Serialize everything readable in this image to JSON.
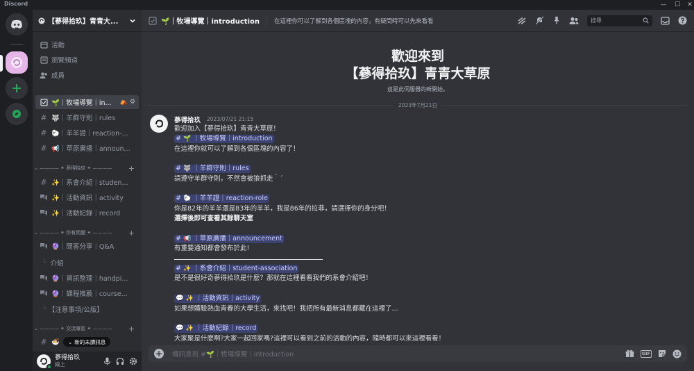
{
  "window": {
    "app_name": "Discord",
    "controls": [
      "minimize-icon",
      "maximize-icon",
      "close-icon"
    ]
  },
  "rail": {
    "icons": [
      "discord-logo-icon",
      "server-avatar-icon",
      "add-server-icon",
      "discover-icon"
    ],
    "accent": "#23a55a"
  },
  "server": {
    "name": "【蔘得拾玖】青青大..."
  },
  "nav": {
    "events": "活動",
    "browse": "瀏覽頻道",
    "members": "成員"
  },
  "channels": [
    {
      "emoji": "🌱",
      "label": "｜牧場導覽｜in...",
      "type": "rules-channel-icon",
      "active": true
    },
    {
      "emoji": "🐺",
      "label": "｜羊群守則｜rules",
      "type": "text-channel-icon"
    },
    {
      "emoji": "🐑",
      "label": "｜羊羊證｜reaction-...",
      "type": "text-channel-icon"
    },
    {
      "emoji": "📢",
      "label": "｜草原廣播｜announ...",
      "type": "text-channel-icon"
    }
  ],
  "categories": [
    {
      "label": "———— ✴ 蔘得拾玖 ✴ ————",
      "channels": [
        {
          "emoji": "✨",
          "label": "｜系會介紹｜studen...",
          "type": "text-channel-icon"
        },
        {
          "emoji": "✨",
          "label": "｜活動資訊｜activity",
          "type": "forum-channel-icon"
        },
        {
          "emoji": "✨",
          "label": "｜活動紀錄｜record",
          "type": "forum-channel-icon"
        }
      ]
    },
    {
      "label": "———— ✴ 你有問題 ✴ ————",
      "channels": [
        {
          "emoji": "🔮",
          "label": "｜問答分享｜Q&A",
          "type": "forum-channel-icon"
        },
        {
          "emoji": "🔮",
          "label": "｜資訊整理｜handpi...",
          "type": "forum-channel-icon"
        },
        {
          "emoji": "🔮",
          "label": "｜課程推薦｜course...",
          "type": "forum-channel-icon"
        }
      ],
      "threads": [
        "介紹",
        "【注意事項/公版】"
      ]
    },
    {
      "label": "———— ✴ 交流專區 ✴ ————",
      "channels": [
        {
          "emoji": "🍜",
          "label": "",
          "type": "text-channel-icon"
        }
      ]
    }
  ],
  "new_unread": "新的未讀訊息",
  "user": {
    "name": "蔘得拾玖",
    "status": "線上"
  },
  "header": {
    "channel_emoji": "🌱",
    "channel_name": "｜牧場導覽｜introduction",
    "topic": "在這裡你可以了解到各個區塊的內容，有疑問時可以先來看看",
    "search_placeholder": "搜尋"
  },
  "welcome": {
    "line1": "歡迎來到",
    "line2": "【蔘得拾玖】青青大草原",
    "subtitle": "這是此伺服器的新開始。",
    "date": "2023年7月21日"
  },
  "message": {
    "author": "蔘得拾玖",
    "timestamp": "2023/07/21 21:15",
    "lines": [
      "歡迎加入【蔘得拾玖】青青大草原！",
      "在這裡你就可以了解到各個區塊的內容了！",
      "請遵守羊群守則，不然會被狼抓走｀´",
      "你是82年的羊羊還是83年的羊羊，我是86年的拉菲，請選擇你的身分吧！",
      "選擇後即可查看其餘聊天室",
      "有重要通知都會發布於此!",
      "是不是很好奇蔘得拾玖是什麼？那就在這裡看看我們的系會介紹吧！",
      "如果想體驗熱血青春的大學生活，來找吧！我把所有最新消息都藏在這裡了...",
      "大家聚是什麼啊?大家一起回家嗎?這裡可以看到之前的活動的內容，隨時都可以來這裡看看！"
    ],
    "mentions": [
      {
        "prefix": "#",
        "emoji": "🌱",
        "text": "｜牧場導覽｜introduction"
      },
      {
        "prefix": "#",
        "emoji": "🐺",
        "text": "｜羊群守則｜rules"
      },
      {
        "prefix": "#",
        "emoji": "🐑",
        "text": "｜羊羊證｜reaction-role"
      },
      {
        "prefix": "#",
        "emoji": "📢",
        "text": "｜草原廣播｜announcement"
      },
      {
        "prefix": "#",
        "emoji": "✨",
        "text": "｜系會介紹｜student-association"
      },
      {
        "prefix": "💬",
        "emoji": "✨",
        "text": "｜活動資訊｜activity"
      },
      {
        "prefix": "💬",
        "emoji": "✨",
        "text": "｜活動紀錄｜record"
      }
    ]
  },
  "composer": {
    "placeholder": "傳訊息到 #🌱｜牧場導覽｜introduction",
    "icons": [
      "gift-icon",
      "gif-icon",
      "sticker-icon",
      "emoji-icon"
    ],
    "gif_label": "GIF"
  }
}
